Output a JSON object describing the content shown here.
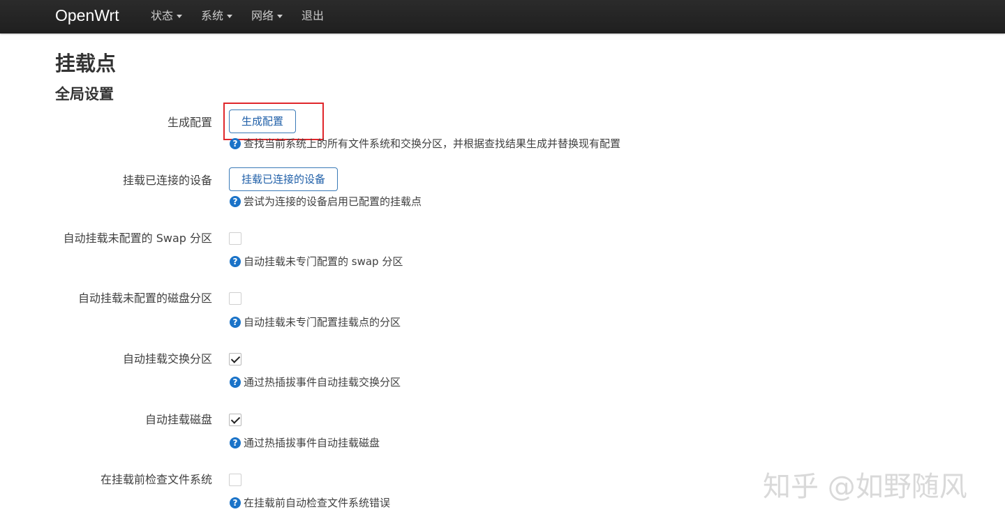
{
  "navbar": {
    "brand": "OpenWrt",
    "menu": [
      {
        "label": "状态",
        "has_dropdown": true
      },
      {
        "label": "系统",
        "has_dropdown": true
      },
      {
        "label": "网络",
        "has_dropdown": true
      },
      {
        "label": "退出",
        "has_dropdown": false
      }
    ]
  },
  "page": {
    "title": "挂载点",
    "section_title": "全局设置"
  },
  "settings": [
    {
      "label": "生成配置",
      "control": "button",
      "button_label": "生成配置",
      "help": "查找当前系统上的所有文件系统和交换分区，并根据查找结果生成并替换现有配置",
      "highlighted": true
    },
    {
      "label": "挂载已连接的设备",
      "control": "button",
      "button_label": "挂载已连接的设备",
      "help": "尝试为连接的设备启用已配置的挂载点"
    },
    {
      "label": "自动挂载未配置的 Swap 分区",
      "control": "checkbox",
      "checked": false,
      "help": "自动挂载未专门配置的 swap 分区"
    },
    {
      "label": "自动挂载未配置的磁盘分区",
      "control": "checkbox",
      "checked": false,
      "help": "自动挂载未专门配置挂载点的分区"
    },
    {
      "label": "自动挂载交换分区",
      "control": "checkbox",
      "checked": true,
      "help": "通过热插拔事件自动挂载交换分区"
    },
    {
      "label": "自动挂载磁盘",
      "control": "checkbox",
      "checked": true,
      "help": "通过热插拔事件自动挂载磁盘"
    },
    {
      "label": "在挂载前检查文件系统",
      "control": "checkbox",
      "checked": false,
      "help": "在挂载前自动检查文件系统错误"
    }
  ],
  "help_icon_glyph": "?",
  "watermark": "知乎 @如野随风",
  "colors": {
    "navbar_bg": "#222222",
    "button_border": "#3a7ab7",
    "button_text": "#1f5fa8",
    "help_icon": "#1a73c8",
    "highlight_box": "#e0262b"
  }
}
